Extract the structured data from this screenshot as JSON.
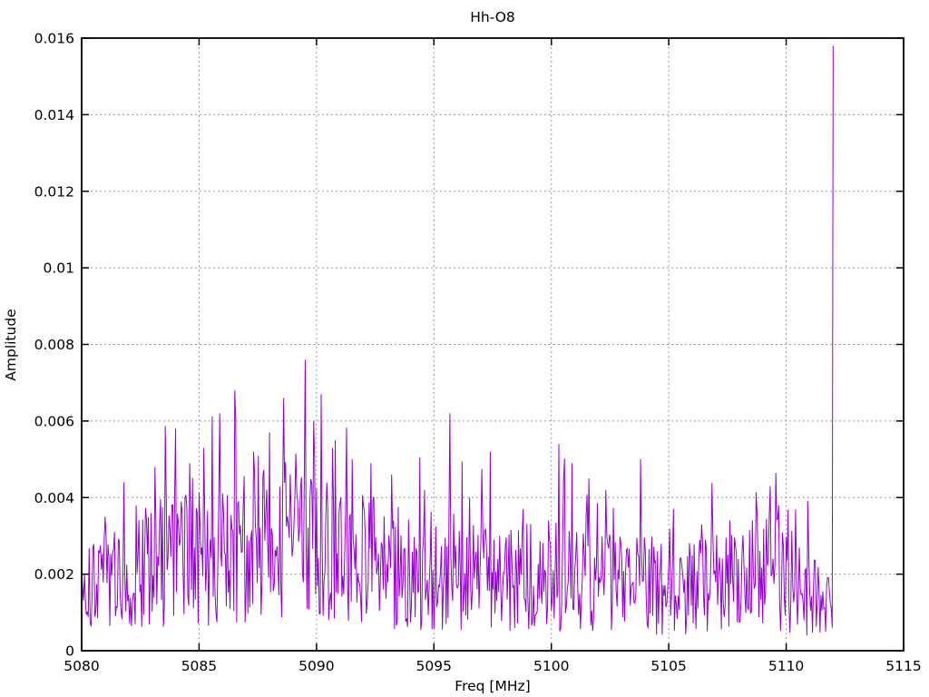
{
  "page": {
    "background": "#ffffff"
  },
  "chart_data": {
    "type": "line",
    "title": "Hh-O8",
    "xlabel": "Freq [MHz]",
    "ylabel": "Amplitude",
    "xlim": [
      5080,
      5115
    ],
    "ylim": [
      0,
      0.016
    ],
    "x_ticks": [
      5080,
      5085,
      5090,
      5095,
      5100,
      5105,
      5110,
      5115
    ],
    "x_tick_labels": [
      "5080",
      "5085",
      "5090",
      "5095",
      "5100",
      "5105",
      "5110",
      "5115"
    ],
    "y_ticks": [
      0,
      0.002,
      0.004,
      0.006,
      0.008,
      0.01,
      0.012,
      0.014,
      0.016
    ],
    "y_tick_labels": [
      "0",
      "0.002",
      "0.004",
      "0.006",
      "0.008",
      "0.01",
      "0.012",
      "0.014",
      "0.016"
    ],
    "grid": true,
    "legend": "none",
    "line_color": "#9400d3",
    "grid_color": "#999999",
    "border_color": "#000000",
    "series_name": "amplitude-spectrum",
    "data_start_mhz": 5080.0,
    "data_end_mhz": 5112.0,
    "sample_step_mhz": 0.04,
    "noise_seed": 20,
    "noise_floor": 0.00015,
    "noise_envelope": [
      [
        5080,
        0.0014
      ],
      [
        5081,
        0.0018
      ],
      [
        5082,
        0.002
      ],
      [
        5083,
        0.0022
      ],
      [
        5084,
        0.0023
      ],
      [
        5085,
        0.0024
      ],
      [
        5086,
        0.0025
      ],
      [
        5087,
        0.0026
      ],
      [
        5088,
        0.0027
      ],
      [
        5089,
        0.0028
      ],
      [
        5090,
        0.0028
      ],
      [
        5091,
        0.0024
      ],
      [
        5092,
        0.0023
      ],
      [
        5093,
        0.0022
      ],
      [
        5094,
        0.002
      ],
      [
        5095,
        0.0019
      ],
      [
        5096,
        0.0019
      ],
      [
        5097,
        0.0019
      ],
      [
        5098,
        0.0018
      ],
      [
        5099,
        0.0019
      ],
      [
        5100,
        0.002
      ],
      [
        5101,
        0.0019
      ],
      [
        5102,
        0.0018
      ],
      [
        5103,
        0.0017
      ],
      [
        5104,
        0.0017
      ],
      [
        5105,
        0.0016
      ],
      [
        5106,
        0.0016
      ],
      [
        5107,
        0.0017
      ],
      [
        5108,
        0.0018
      ],
      [
        5109,
        0.0021
      ],
      [
        5110,
        0.0019
      ],
      [
        5111,
        0.0015
      ],
      [
        5111.8,
        0.0012
      ],
      [
        5112,
        0.001
      ]
    ],
    "peaks": [
      [
        5081.0,
        0.0035
      ],
      [
        5081.8,
        0.0044
      ],
      [
        5082.3,
        0.0038
      ],
      [
        5083.1,
        0.0048
      ],
      [
        5083.6,
        0.0041
      ],
      [
        5084.0,
        0.0058
      ],
      [
        5084.6,
        0.0049
      ],
      [
        5085.2,
        0.0053
      ],
      [
        5085.9,
        0.0062
      ],
      [
        5086.5,
        0.0068
      ],
      [
        5087.3,
        0.0052
      ],
      [
        5088.0,
        0.0057
      ],
      [
        5088.6,
        0.0066
      ],
      [
        5089.5,
        0.0076
      ],
      [
        5089.9,
        0.006
      ],
      [
        5090.2,
        0.0067
      ],
      [
        5090.8,
        0.0055
      ],
      [
        5091.5,
        0.005
      ],
      [
        5092.3,
        0.0049
      ],
      [
        5093.2,
        0.0046
      ],
      [
        5094.6,
        0.0042
      ],
      [
        5095.7,
        0.0062
      ],
      [
        5096.5,
        0.004
      ],
      [
        5097.4,
        0.0052
      ],
      [
        5098.8,
        0.0037
      ],
      [
        5100.3,
        0.0054
      ],
      [
        5100.9,
        0.0049
      ],
      [
        5101.6,
        0.0045
      ],
      [
        5102.3,
        0.0042
      ],
      [
        5103.8,
        0.005
      ],
      [
        5105.2,
        0.0037
      ],
      [
        5106.4,
        0.0033
      ],
      [
        5107.6,
        0.0034
      ],
      [
        5109.3,
        0.0043
      ],
      [
        5109.7,
        0.0038
      ]
    ],
    "main_peak": {
      "freq_mhz": 5112.0,
      "amplitude": 0.0158
    }
  }
}
